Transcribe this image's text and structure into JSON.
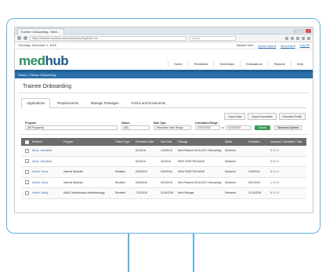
{
  "browser": {
    "tab_title": "Trainee Onboarding - Med...",
    "url": "https://medhub.medhub.com/u/a/onboarding/index.mh",
    "search_placeholder": "Search"
  },
  "topinfo": {
    "date": "Thursday, December 1, 2016",
    "user": "Sample User",
    "links": [
      "Quick Links ▾",
      "Accounts ▾",
      "Log Off"
    ]
  },
  "brand": {
    "logo_med": "med",
    "logo_hub": "hub"
  },
  "nav": {
    "items": [
      "Home",
      "Residents",
      "Schedules",
      "Evaluations",
      "Reports",
      "Help"
    ]
  },
  "breadcrumb": "Home » Trainee Onboarding",
  "page": {
    "title": "Trainee Onboarding"
  },
  "subtabs": [
    "Applications",
    "Requirements",
    "Manage Packages",
    "Forms and Documents"
  ],
  "actions": [
    "Export Data",
    "Export Documents",
    "Document Profile"
  ],
  "filters": {
    "program_label": "Program:",
    "program_value": "(All Programs)",
    "status_label": "Status:",
    "status_value": "(All)",
    "date_type_label": "Date Type:",
    "date_type_value": "Orientation Date Range",
    "date_range_label": "Orientation Range:",
    "date_from": "07/01/2016",
    "to_label": "to",
    "date_to": "12/31/2016",
    "search_label": "Search",
    "advanced_label": "Advanced Options"
  },
  "table": {
    "headers": [
      "",
      "Resident",
      "Program",
      "Trainee Type",
      "Orientation Date",
      "Start Date",
      "Package",
      "Status",
      "Submitted",
      "Uploaded / Submitted / Total"
    ],
    "rows": [
      [
        "Alexa, Johnathan",
        "",
        "",
        "6/1/2016",
        "1/20/2016",
        "New Resident 2016-2017 Onboarding",
        "Delivered",
        "",
        "0 / 0 / 1"
      ],
      [
        "Alexa, Johnathan",
        "",
        "",
        "6/1/2016",
        "3/1/2016",
        "NEW YEAR PACKAGE",
        "Delivered",
        "",
        "0 / 0 / 1"
      ],
      [
        "Daniel, Jenna",
        "Internal Medicine",
        "Resident",
        "6/30/2016",
        "6/30/2016",
        "NEW YEAR PACKAGE",
        "Delivered",
        "2/29/2016",
        "0 / 0 / 1"
      ],
      [
        "Daniel, Jenna",
        "Internal Medicine",
        "Resident",
        "6/30/2016",
        "6/19/2016",
        "New Resident 2016-2017 Onboarding",
        "Delivered",
        "6/27/2016",
        "1 / 1 / 4"
      ],
      [
        "Harlan, Becky",
        "AAIB Cardiothoracic Anesthesiology",
        "Resident",
        "7/21/2016",
        "11/16/2016",
        "New Package",
        "Delivered",
        "11/10/2016",
        "0 / 1 / 3"
      ]
    ]
  },
  "colors": {
    "accent_border": "#5fb3de",
    "nav_blue": "#1f5f94",
    "logo_green": "#2f8f5e",
    "search_green": "#3c9a54"
  }
}
